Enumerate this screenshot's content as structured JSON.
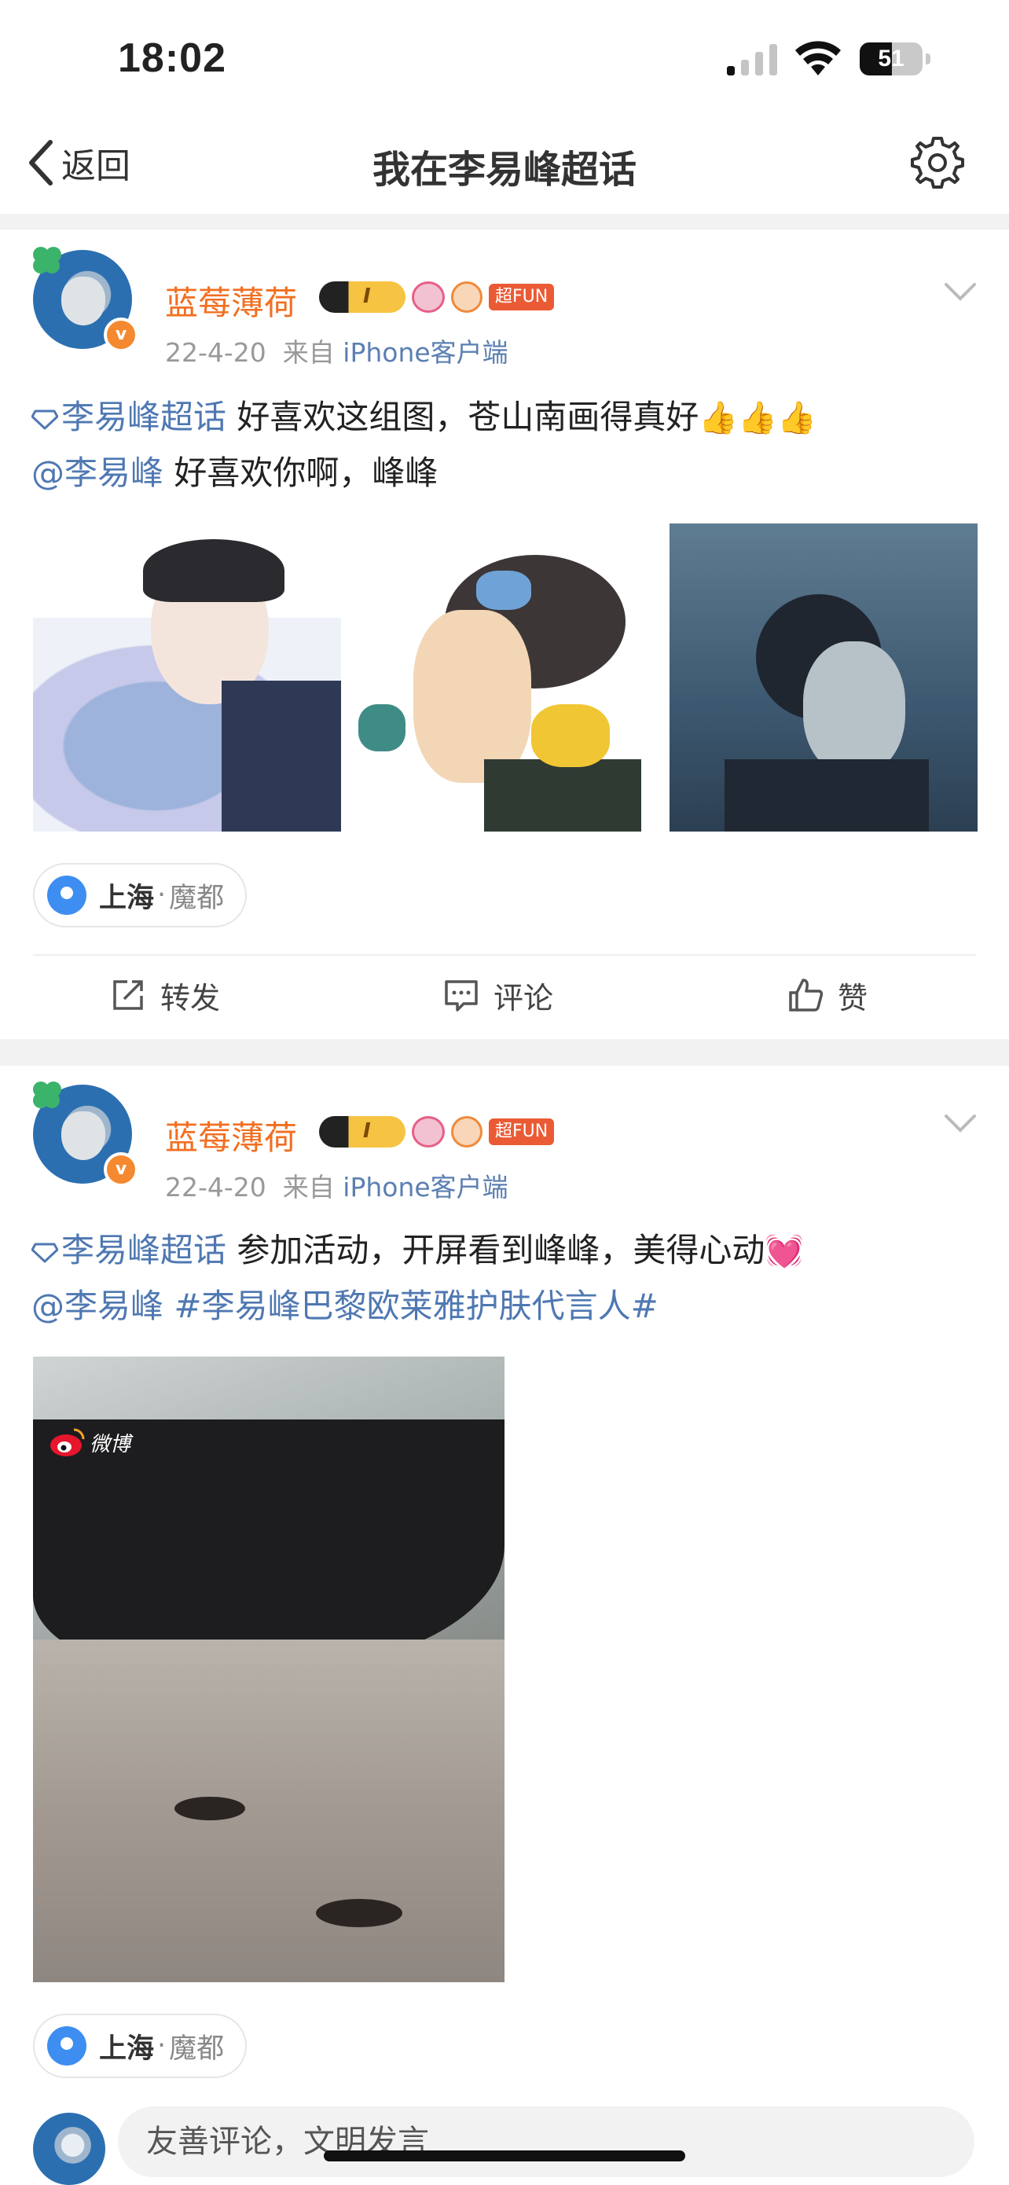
{
  "status_bar": {
    "time": "18:02",
    "battery": "51",
    "battery_level": 0.51
  },
  "navbar": {
    "back_label": "返回",
    "title": "我在李易峰超话"
  },
  "posts": [
    {
      "username": "蓝莓薄荷",
      "badge_level": "I",
      "badge_fun": "超FUN",
      "date": "22-4-20",
      "from_label": "来自",
      "source": "iPhone客户端",
      "topic": "李易峰超话",
      "text1": "好喜欢这组图，苍山南画得真好",
      "emoji1": "👍👍👍",
      "mention": "@李易峰",
      "text2": "好喜欢你啊，峰峰",
      "location_city": "上海",
      "location_sep": "·",
      "location_area": "魔都",
      "actions": {
        "repost": "转发",
        "comment": "评论",
        "like": "赞"
      }
    },
    {
      "username": "蓝莓薄荷",
      "badge_level": "I",
      "badge_fun": "超FUN",
      "date": "22-4-20",
      "from_label": "来自",
      "source": "iPhone客户端",
      "topic": "李易峰超话",
      "text1": "参加活动，开屏看到峰峰，美得心动",
      "emoji1": "💓",
      "mention": "@李易峰",
      "hashtag": "#李易峰巴黎欧莱雅护肤代言人#",
      "image_watermark": "微博",
      "location_city": "上海",
      "location_sep": "·",
      "location_area": "魔都"
    }
  ],
  "comment_bar": {
    "placeholder": "友善评论，文明发言"
  },
  "colors": {
    "username": "#f26f21",
    "link": "#4f78b2",
    "separator": "#f2f2f2"
  }
}
